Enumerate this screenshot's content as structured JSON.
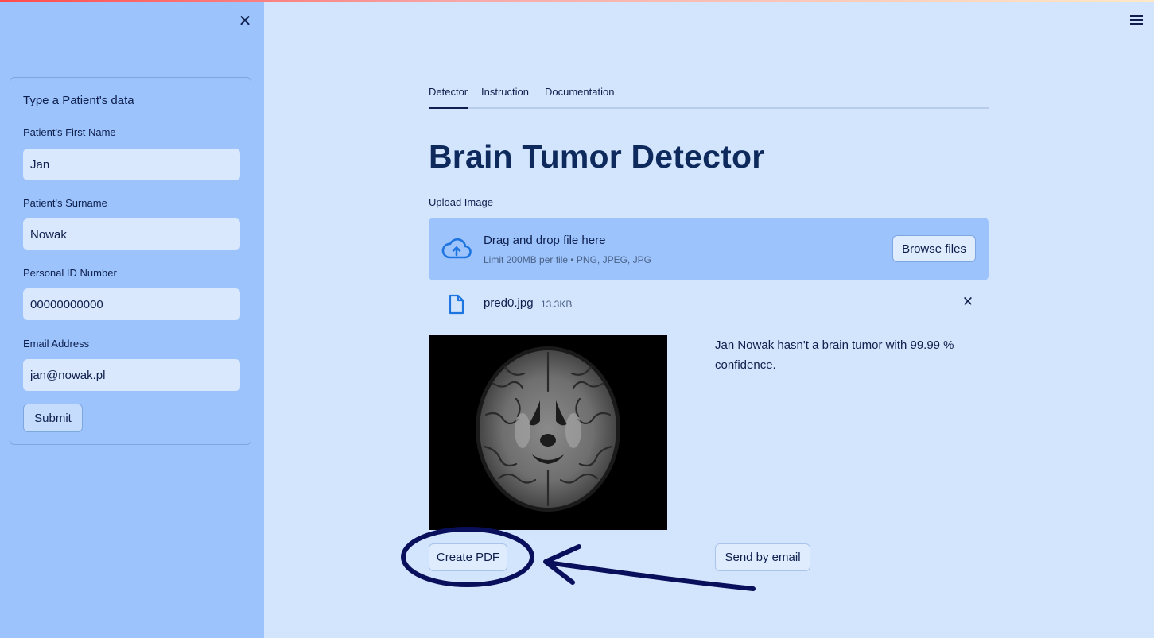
{
  "sidebar": {
    "close_icon": "close-icon",
    "form_title": "Type a Patient's data",
    "fields": [
      {
        "label": "Patient's First Name",
        "value": "Jan"
      },
      {
        "label": "Patient's Surname",
        "value": "Nowak"
      },
      {
        "label": "Personal ID Number",
        "value": "00000000000"
      },
      {
        "label": "Email Address",
        "value": "jan@nowak.pl"
      }
    ],
    "submit_label": "Submit"
  },
  "header": {
    "menu_icon": "hamburger-menu-icon"
  },
  "tabs": [
    {
      "label": "Detector",
      "active": true
    },
    {
      "label": "Instruction",
      "active": false
    },
    {
      "label": "Documentation",
      "active": false
    }
  ],
  "main": {
    "title": "Brain Tumor Detector",
    "upload": {
      "label": "Upload Image",
      "drag_text": "Drag and drop file here",
      "limit_text": "Limit 200MB per file • PNG, JPEG, JPG",
      "browse_label": "Browse files"
    },
    "file": {
      "name": "pred0.jpg",
      "size": "13.3KB"
    },
    "result": "Jan Nowak hasn't a brain tumor with 99.99 % confidence.",
    "create_pdf_label": "Create PDF",
    "send_email_label": "Send by email"
  },
  "colors": {
    "sidebar_bg": "#9cc3fc",
    "main_bg": "#d3e5fd",
    "text": "#0e1f4d",
    "annotation": "#0a0f5c"
  }
}
